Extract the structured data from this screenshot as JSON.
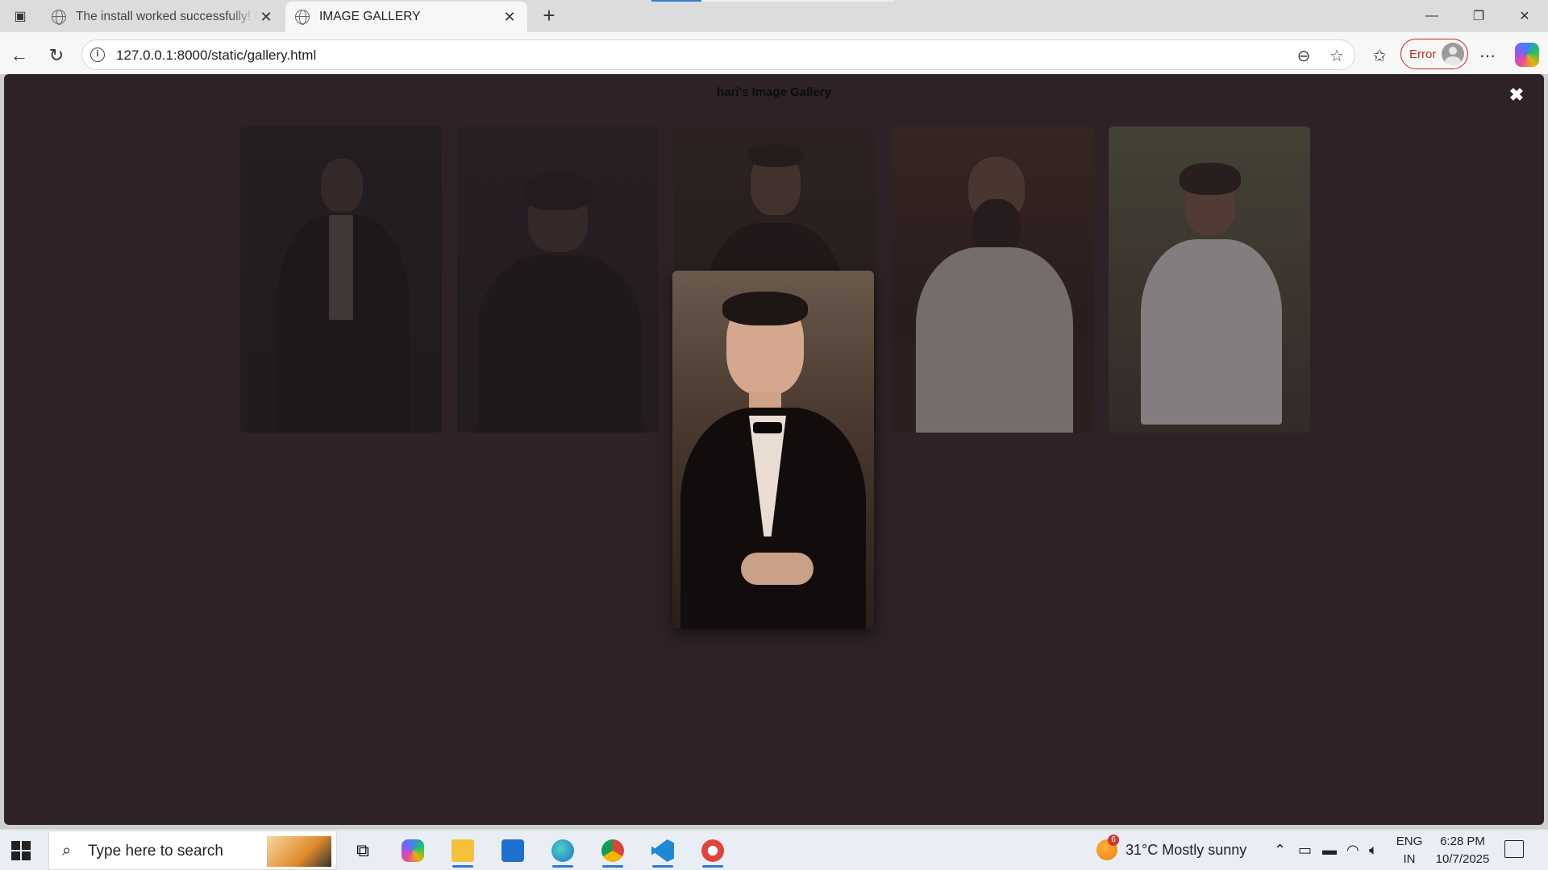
{
  "browser": {
    "tabs": [
      {
        "title": "The install worked successfully! Co",
        "active": false
      },
      {
        "title": "IMAGE GALLERY",
        "active": true
      }
    ],
    "url": "127.0.0.1:8000/static/gallery.html",
    "profile_status": "Error"
  },
  "page": {
    "title": "hari's Image Gallery",
    "close_symbol": "✖",
    "selected_image_index": 2,
    "images": [
      {
        "alt": "Man in dark suit holding glass",
        "tone": "dark"
      },
      {
        "alt": "Bearded man in black suit",
        "tone": "dark"
      },
      {
        "alt": "Man in tuxedo with bow tie",
        "tone": "warm"
      },
      {
        "alt": "Bearded man in white suit",
        "tone": "warm"
      },
      {
        "alt": "Man in white shirt outdoors",
        "tone": "green"
      }
    ]
  },
  "taskbar": {
    "search_placeholder": "Type here to search",
    "weather_badge": "6",
    "weather": "31°C  Mostly sunny",
    "lang_line1": "ENG",
    "lang_line2": "IN",
    "time": "6:28 PM",
    "date": "10/7/2025"
  },
  "colors": {
    "page_background": "#2f2226",
    "error_accent": "#c42b1c",
    "taskbar_accent": "#2a78d6"
  }
}
